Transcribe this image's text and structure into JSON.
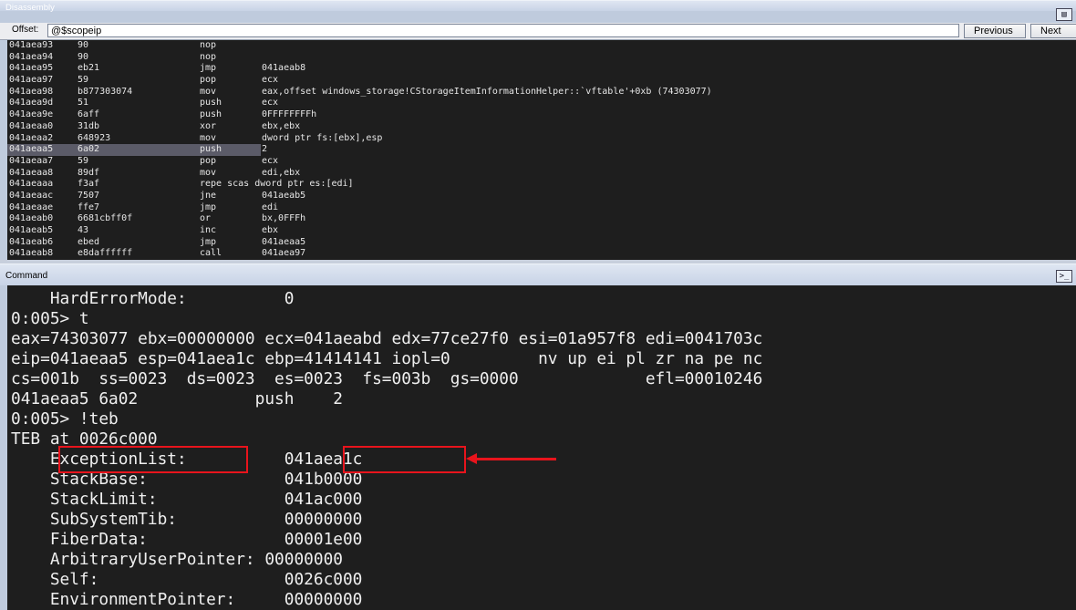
{
  "disassembly": {
    "title": "Disassembly",
    "offset_label": "Offset:",
    "offset_value": "@$scopeip",
    "prev_label": "Previous",
    "next_label": "Next",
    "rows": [
      {
        "addr": "041aea93",
        "bytes": "90",
        "mnemonic": "nop",
        "operands": ""
      },
      {
        "addr": "041aea94",
        "bytes": "90",
        "mnemonic": "nop",
        "operands": ""
      },
      {
        "addr": "041aea95",
        "bytes": "eb21",
        "mnemonic": "jmp",
        "operands": "041aeab8"
      },
      {
        "addr": "041aea97",
        "bytes": "59",
        "mnemonic": "pop",
        "operands": "ecx"
      },
      {
        "addr": "041aea98",
        "bytes": "b877303074",
        "mnemonic": "mov",
        "operands": "eax,offset windows_storage!CStorageItemInformationHelper::`vftable'+0xb (74303077)"
      },
      {
        "addr": "041aea9d",
        "bytes": "51",
        "mnemonic": "push",
        "operands": "ecx"
      },
      {
        "addr": "041aea9e",
        "bytes": "6aff",
        "mnemonic": "push",
        "operands": "0FFFFFFFFh"
      },
      {
        "addr": "041aeaa0",
        "bytes": "31db",
        "mnemonic": "xor",
        "operands": "ebx,ebx"
      },
      {
        "addr": "041aeaa2",
        "bytes": "648923",
        "mnemonic": "mov",
        "operands": "dword ptr fs:[ebx],esp"
      },
      {
        "addr": "041aeaa5",
        "bytes": "6a02",
        "mnemonic": "push",
        "operands": "2",
        "highlight": true
      },
      {
        "addr": "041aeaa7",
        "bytes": "59",
        "mnemonic": "pop",
        "operands": "ecx"
      },
      {
        "addr": "041aeaa8",
        "bytes": "89df",
        "mnemonic": "mov",
        "operands": "edi,ebx"
      },
      {
        "addr": "041aeaaa",
        "bytes": "f3af",
        "mnemonic": "repe scas dword ptr es:[edi]",
        "operands": ""
      },
      {
        "addr": "041aeaac",
        "bytes": "7507",
        "mnemonic": "jne",
        "operands": "041aeab5"
      },
      {
        "addr": "041aeaae",
        "bytes": "ffe7",
        "mnemonic": "jmp",
        "operands": "edi"
      },
      {
        "addr": "041aeab0",
        "bytes": "6681cbff0f",
        "mnemonic": "or",
        "operands": "bx,0FFFh"
      },
      {
        "addr": "041aeab5",
        "bytes": "43",
        "mnemonic": "inc",
        "operands": "ebx"
      },
      {
        "addr": "041aeab6",
        "bytes": "ebed",
        "mnemonic": "jmp",
        "operands": "041aeaa5"
      },
      {
        "addr": "041aeab8",
        "bytes": "e8daffffff",
        "mnemonic": "call",
        "operands": "041aea97"
      }
    ]
  },
  "command": {
    "title": "Command",
    "lines": [
      "    HardErrorMode:          0",
      "0:005> t",
      "eax=74303077 ebx=00000000 ecx=041aeabd edx=77ce27f0 esi=01a957f8 edi=0041703c",
      "eip=041aeaa5 esp=041aea1c ebp=41414141 iopl=0         nv up ei pl zr na pe nc",
      "cs=001b  ss=0023  ds=0023  es=0023  fs=003b  gs=0000             efl=00010246",
      "041aeaa5 6a02            push    2",
      "0:005> !teb",
      "TEB at 0026c000",
      "    ExceptionList:          041aea1c",
      "    StackBase:              041b0000",
      "    StackLimit:             041ac000",
      "    SubSystemTib:           00000000",
      "    FiberData:              00001e00",
      "    ArbitraryUserPointer: 00000000",
      "    Self:                   0026c000",
      "    EnvironmentPointer:     00000000"
    ]
  },
  "colors": {
    "highlight_box": "#e8141c",
    "console_bg": "#1e1e1e"
  },
  "icons": {
    "disassembly_icon": "window-source-icon",
    "command_icon": "console-prompt-icon"
  }
}
